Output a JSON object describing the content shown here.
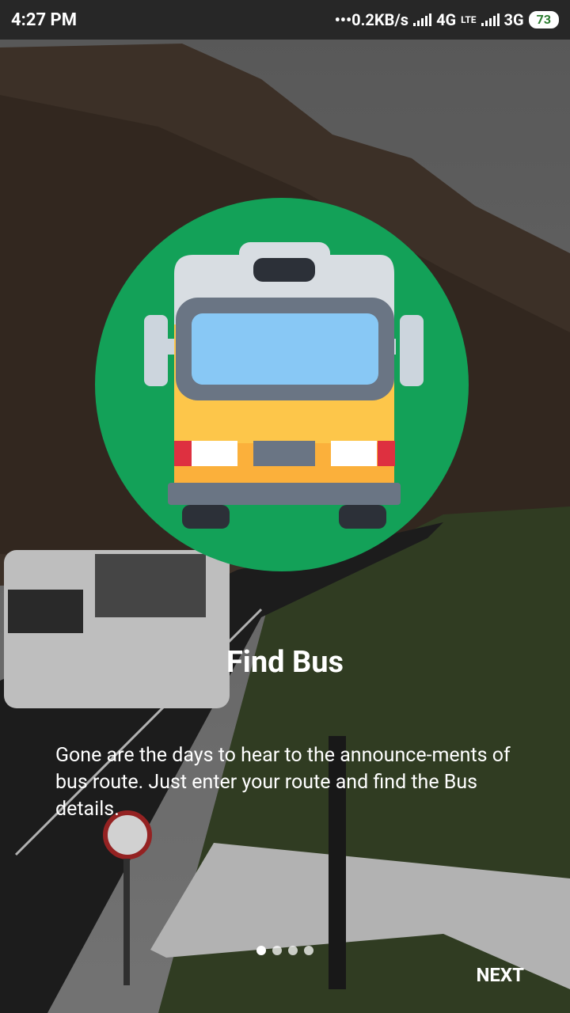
{
  "status_bar": {
    "time": "4:27 PM",
    "speed": "0.2KB/s",
    "network1": "4G",
    "volte": "LTE",
    "network2": "3G",
    "battery": "73"
  },
  "slide": {
    "title": "Find Bus",
    "description": "Gone are the days to hear to the announce-ments of bus route. Just enter your route and find the Bus details.",
    "icon": "bus-icon"
  },
  "pager": {
    "total": 4,
    "active_index": 0
  },
  "next_label": "NEXT"
}
